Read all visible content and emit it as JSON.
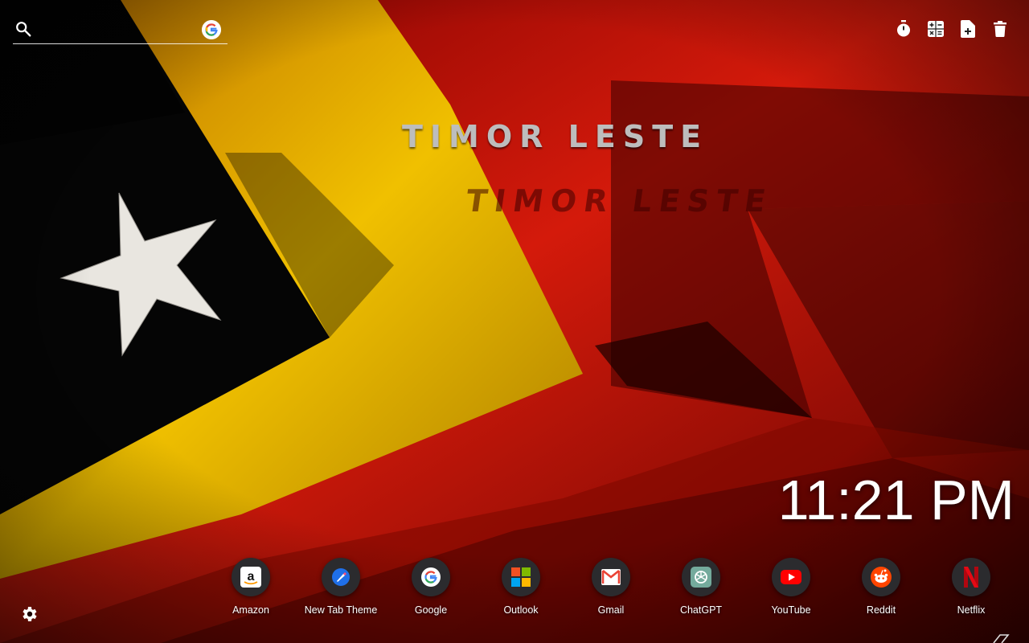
{
  "search": {
    "placeholder": "",
    "value": "",
    "engine_icon": "google-icon"
  },
  "toolbar": {
    "items": [
      {
        "icon": "timer-icon"
      },
      {
        "icon": "calculator-icon"
      },
      {
        "icon": "new-note-icon"
      },
      {
        "icon": "trash-icon"
      }
    ]
  },
  "wallpaper": {
    "text": "TIMOR LESTE",
    "colors": {
      "red": "#c0160c",
      "yellow": "#e8b400",
      "black": "#050505",
      "star": "#e9e6e0"
    }
  },
  "clock": {
    "time": "11:21 PM"
  },
  "shortcuts": [
    {
      "label": "Amazon",
      "icon": "amazon-icon"
    },
    {
      "label": "New Tab Theme",
      "icon": "new-tab-theme-icon"
    },
    {
      "label": "Google",
      "icon": "google-icon"
    },
    {
      "label": "Outlook",
      "icon": "microsoft-icon"
    },
    {
      "label": "Gmail",
      "icon": "gmail-icon"
    },
    {
      "label": "ChatGPT",
      "icon": "chatgpt-icon"
    },
    {
      "label": "YouTube",
      "icon": "youtube-icon"
    },
    {
      "label": "Reddit",
      "icon": "reddit-icon"
    },
    {
      "label": "Netflix",
      "icon": "netflix-icon"
    }
  ],
  "footer": {
    "settings_icon": "gear-icon"
  }
}
